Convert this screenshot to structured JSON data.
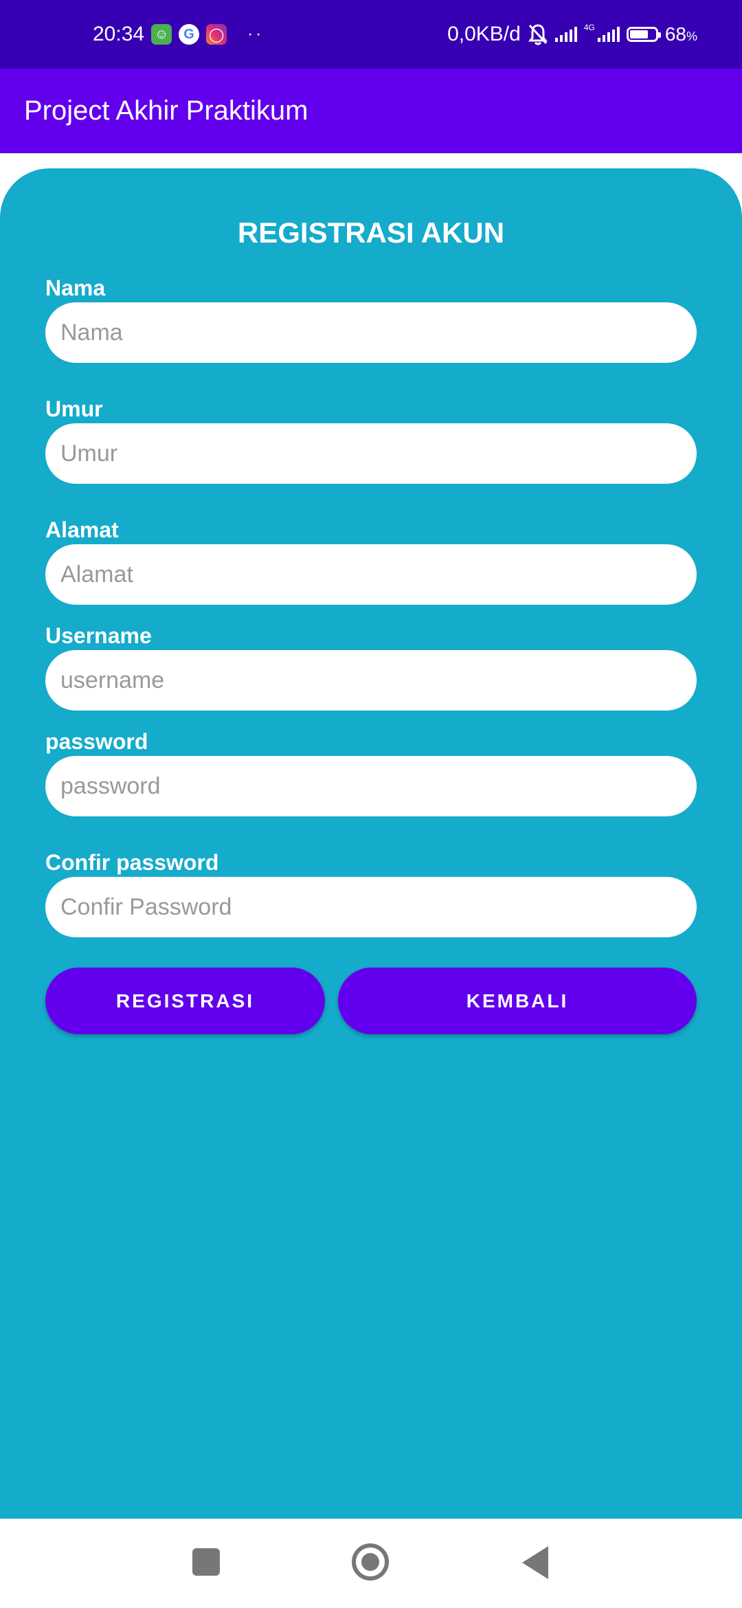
{
  "status_bar": {
    "time": "20:34",
    "notification_icons": [
      "android-messages-icon",
      "google-icon",
      "instagram-icon"
    ],
    "more": "··",
    "network_speed": "0,0KB/d",
    "network_type": "4G",
    "battery_level": 68,
    "battery_text": "68",
    "battery_unit": "%"
  },
  "app_bar": {
    "title": "Project Akhir Praktikum"
  },
  "form": {
    "title": "REGISTRASI AKUN",
    "fields": [
      {
        "label": "Nama",
        "placeholder": "Nama",
        "value": ""
      },
      {
        "label": "Umur",
        "placeholder": "Umur",
        "value": ""
      },
      {
        "label": "Alamat",
        "placeholder": "Alamat",
        "value": ""
      },
      {
        "label": "Username",
        "placeholder": "username",
        "value": ""
      },
      {
        "label": "password",
        "placeholder": "password",
        "value": ""
      },
      {
        "label": "Confir password",
        "placeholder": "Confir Password",
        "value": ""
      }
    ],
    "register_button": "REGISTRASI",
    "back_button": "KEMBALI"
  },
  "colors": {
    "status_bar": "#3700b3",
    "app_bar": "#6200ee",
    "card": "#15abca",
    "button": "#6200ee"
  },
  "nav_bar": {
    "icons": [
      "recent-apps-icon",
      "home-icon",
      "back-icon"
    ]
  }
}
